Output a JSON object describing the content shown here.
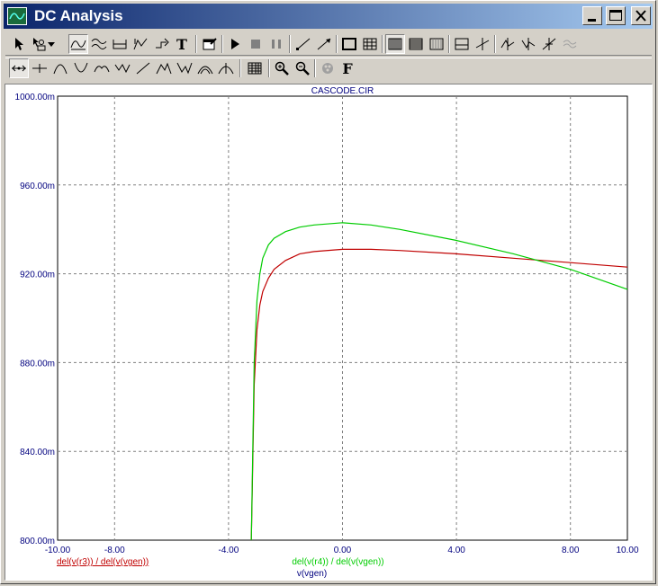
{
  "window": {
    "title": "DC Analysis"
  },
  "title_buttons": {
    "minimize": "minimize",
    "maximize": "maximize",
    "close": "close"
  },
  "toolbar": {
    "row1": [
      "select-arrow-icon",
      "select-mode-icon",
      "dropdown-arrow-icon",
      "graph-mode-icon",
      "scale-mode-icon",
      "trace-icon",
      "cursor-mode-icon",
      "tag-mode-icon",
      "text-mode-icon",
      "properties-icon",
      "run-icon",
      "stop-icon",
      "pause-icon",
      "line-icon",
      "line-arrow-icon",
      "plot-frame-icon",
      "grid-icon",
      "grid-minor-icon",
      "grid-major-icon",
      "grid-bold-icon",
      "axis-icon",
      "cross-icon",
      "peak-icon",
      "valley-icon",
      "slope-icon",
      "waveform-icon"
    ],
    "row2": [
      "cursor-left-icon",
      "cursor-right-icon",
      "peak-left-icon",
      "valley-icon",
      "high-icon",
      "low-icon",
      "inflection-icon",
      "global-high-icon",
      "global-low-icon",
      "top-icon",
      "bottom-icon",
      "data-table-icon",
      "zoom-in-icon",
      "zoom-out-icon",
      "color-icon",
      "font-icon"
    ],
    "font_label": "F",
    "text_label": "T"
  },
  "chart_data": {
    "type": "line",
    "title": "CASCODE.CIR",
    "xlabel": "v(vgen)",
    "xlim": [
      -10,
      10
    ],
    "ylim": [
      0.8,
      1.0
    ],
    "x_ticks": [
      "-10.00",
      "-8.00",
      "-4.00",
      "0.00",
      "4.00",
      "8.00",
      "10.00"
    ],
    "y_ticks": [
      "1000.00m",
      "960.00m",
      "920.00m",
      "880.00m",
      "840.00m",
      "800.00m"
    ],
    "grid": true,
    "series": [
      {
        "name": "del(v(r3)) / del(v(vgen))",
        "color": "#c00000",
        "x": [
          -3.2,
          -3.1,
          -3.0,
          -2.9,
          -2.8,
          -2.6,
          -2.4,
          -2.0,
          -1.5,
          -1.0,
          0.0,
          1.0,
          2.0,
          4.0,
          6.0,
          8.0,
          10.0
        ],
        "y": [
          0.8,
          0.87,
          0.895,
          0.906,
          0.912,
          0.918,
          0.922,
          0.926,
          0.929,
          0.93,
          0.931,
          0.931,
          0.9305,
          0.929,
          0.927,
          0.925,
          0.923
        ]
      },
      {
        "name": "del(v(r4)) / del(v(vgen))",
        "color": "#00cc00",
        "x": [
          -3.2,
          -3.1,
          -3.0,
          -2.9,
          -2.8,
          -2.6,
          -2.4,
          -2.0,
          -1.5,
          -1.0,
          0.0,
          1.0,
          2.0,
          4.0,
          6.0,
          8.0,
          10.0
        ],
        "y": [
          0.8,
          0.88,
          0.908,
          0.92,
          0.927,
          0.933,
          0.936,
          0.939,
          0.941,
          0.942,
          0.943,
          0.942,
          0.94,
          0.935,
          0.929,
          0.922,
          0.913
        ]
      }
    ]
  }
}
